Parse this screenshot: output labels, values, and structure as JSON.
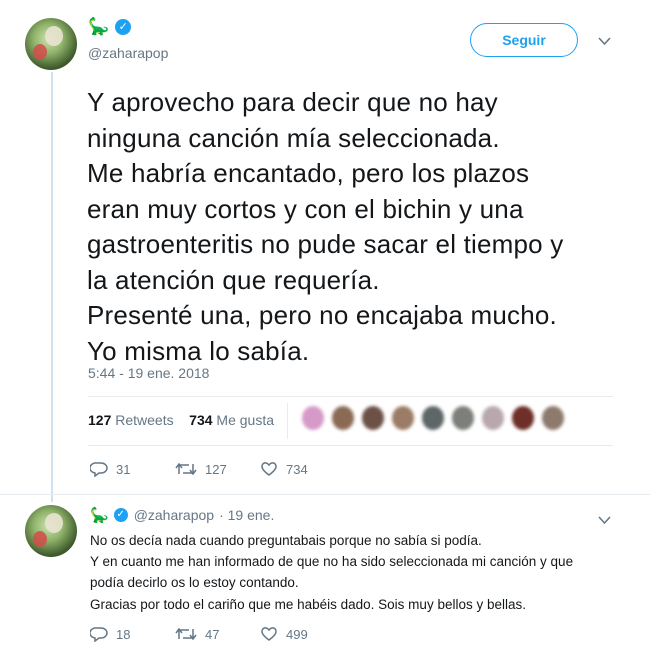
{
  "tweet": {
    "handle": "@zaharapop",
    "emoji_icon": "dinosaur-icon",
    "follow_label": "Seguir",
    "text_lines": [
      "Y aprovecho para decir que no hay",
      "ninguna canción mía seleccionada.",
      "Me habría encantado, pero los plazos",
      "eran muy cortos y con el bichin y una",
      "gastroenteritis no pude sacar el tiempo y",
      "la atención que requería.",
      "Presenté una, pero no encajaba mucho.",
      "Yo misma lo sabía."
    ],
    "timestamp": "5:44 - 19 ene. 2018",
    "retweets_count": "127",
    "retweets_label": "Retweets",
    "likes_count": "734",
    "likes_label": "Me gusta",
    "actions": {
      "replies": "31",
      "retweets": "127",
      "likes": "734"
    }
  },
  "reply": {
    "handle": "@zaharapop",
    "date": "· 19 ene.",
    "text_lines": [
      "No os decía nada cuando preguntabais porque no sabía si podía.",
      "Y en cuanto me han informado de que no ha sido seleccionada mi canción y que",
      "podía decirlo os lo estoy contando.",
      "Gracias por todo el cariño que me habéis dado. Sois muy bellos y bellas."
    ],
    "actions": {
      "replies": "18",
      "retweets": "47",
      "likes": "499"
    }
  },
  "colors": {
    "accent": "#1da1f2",
    "text": "#14171a",
    "muted": "#657786"
  }
}
